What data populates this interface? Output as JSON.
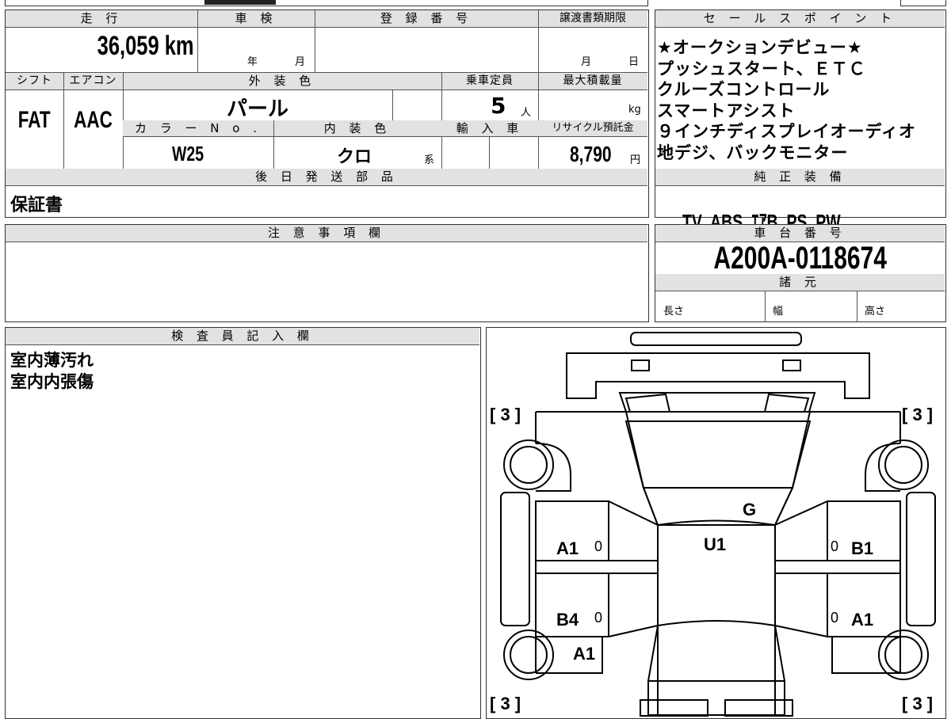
{
  "headers": {
    "mileage": "走 行",
    "inspection": "車 検",
    "registration": "登 録 番 号",
    "transfer_deadline": "譲渡書類期限",
    "sales_points": "セ ー ル ス ポ イ ン ト",
    "shift": "シフト",
    "aircon": "エアコン",
    "exterior_color": "外 装 色",
    "capacity": "乗車定員",
    "max_load": "最大積載量",
    "color_no": "カ ラ ー N o .",
    "interior_color": "内 装 色",
    "import": "輸 入 車",
    "recycle": "リサイクル預託金",
    "later_parts": "後 日 発 送 部 品",
    "genuine_equipment": "純 正 装 備",
    "notes": "注 意 事 項 欄",
    "chassis": "車 台 番 号",
    "specs": "諸 元",
    "inspector": "検 査 員 記 入 欄"
  },
  "vehicle": {
    "mileage": "36,059 km",
    "inspection_year_unit": "年",
    "inspection_month_unit": "月",
    "deadline_month_unit": "月",
    "deadline_day_unit": "日",
    "shift": "FAT",
    "aircon": "AAC",
    "exterior_color": "パール",
    "capacity": "5",
    "capacity_unit": "人",
    "max_load_unit": "kg",
    "color_no": "W25",
    "interior_color": "クロ",
    "interior_suffix": "系",
    "recycle_fee": "8,790",
    "recycle_unit": "円",
    "later_parts": "保証書",
    "genuine_equipment": "TV  ABS  ｴｱB  PS  PW",
    "chassis_number": "A200A-0118674",
    "spec_length": "長さ",
    "spec_width": "幅",
    "spec_height": "高さ"
  },
  "sales_points": [
    "★オークションデビュー★",
    "プッシュスタート、ＥＴＣ",
    "クルーズコントロール",
    "スマートアシスト",
    "９インチディスプレイオーディオ",
    "地デジ、バックモニター"
  ],
  "inspector_notes": [
    "室内薄汚れ",
    "室内内張傷"
  ],
  "diagram_marks": {
    "front_left": "[ 3 ]",
    "front_right": "[ 3 ]",
    "rear_left": "[ 3 ]",
    "rear_right": "[ 3 ]",
    "windshield": "G",
    "roof": "U1",
    "left_front_door": "A1",
    "left_rear_door": "B4",
    "left_rear_fender": "A1",
    "right_front_door": "B1",
    "right_rear_door": "A1",
    "zero_1": "0",
    "zero_2": "0",
    "zero_3": "0",
    "zero_4": "0"
  }
}
